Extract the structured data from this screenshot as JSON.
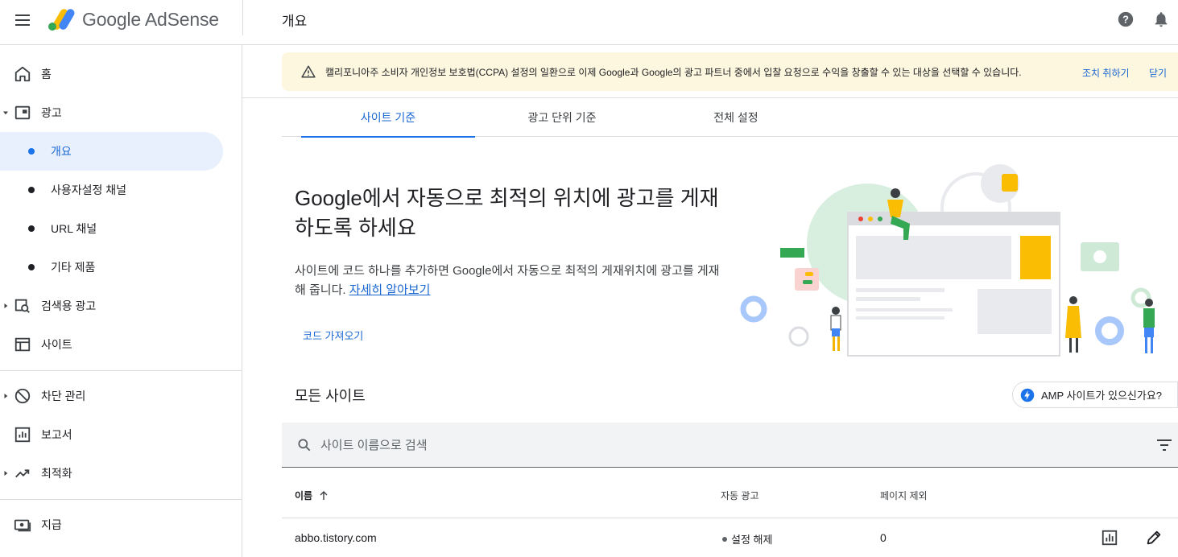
{
  "header": {
    "app_name": "Google AdSense",
    "page_title": "개요"
  },
  "sidebar": {
    "items": [
      {
        "label": "홈",
        "icon": "home-icon"
      },
      {
        "label": "광고",
        "icon": "ads-icon",
        "expanded": true
      },
      {
        "label": "개요",
        "sub": true,
        "active": true
      },
      {
        "label": "사용자설정 채널",
        "sub": true
      },
      {
        "label": "URL 채널",
        "sub": true
      },
      {
        "label": "기타 제품",
        "sub": true
      },
      {
        "label": "검색용 광고",
        "icon": "search-ads-icon",
        "collapsed": true
      },
      {
        "label": "사이트",
        "icon": "sites-icon"
      },
      {
        "label": "차단 관리",
        "icon": "block-icon",
        "collapsed": true
      },
      {
        "label": "보고서",
        "icon": "reports-icon"
      },
      {
        "label": "최적화",
        "icon": "optimize-icon",
        "collapsed": true
      },
      {
        "label": "지급",
        "icon": "payments-icon"
      }
    ]
  },
  "banner": {
    "text": "캘리포니아주 소비자 개인정보 보호법(CCPA) 설정의 일환으로 이제 Google과 Google의 광고 파트너 중에서 입찰 요청으로 수익을 창출할 수 있는 대상을 선택할 수 있습니다.",
    "action_label": "조치 취하기",
    "dismiss_label": "닫기",
    "background": "#fef7e0"
  },
  "tabs": [
    {
      "label": "사이트 기준",
      "active": true
    },
    {
      "label": "광고 단위 기준"
    },
    {
      "label": "전체 설정"
    }
  ],
  "hero": {
    "title": "Google에서 자동으로 최적의 위치에 광고를 게재하도록 하세요",
    "description": "사이트에 코드 하나를 추가하면 Google에서 자동으로 최적의 게재위치에 광고를 게재해 줍니다.",
    "learn_more": "자세히 알아보기",
    "get_code_label": "코드 가져오기"
  },
  "sites": {
    "section_title": "모든 사이트",
    "amp_chip": "AMP 사이트가 있으신가요?",
    "search_placeholder": "사이트 이름으로 검색",
    "columns": [
      "이름",
      "자동 광고",
      "페이지 제외"
    ],
    "rows": [
      {
        "name": "abbo.tistory.com",
        "auto_ads": "설정 해제",
        "excluded_pages": "0"
      }
    ]
  },
  "colors": {
    "accent": "#1a73e8",
    "active_nav_bg": "#e8f0fe"
  }
}
